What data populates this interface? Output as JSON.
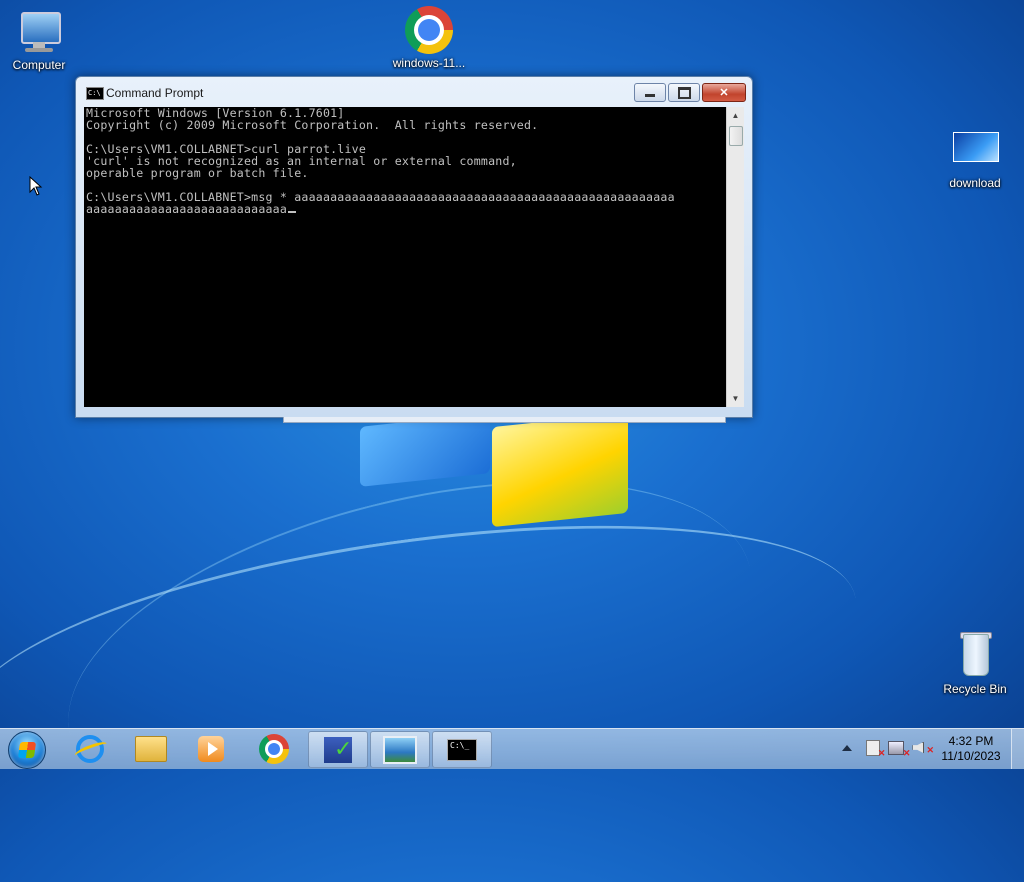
{
  "desktop": {
    "icons": [
      {
        "label": "Computer",
        "icon": "computer-icon"
      },
      {
        "label": "windows-11...",
        "icon": "chrome-icon"
      },
      {
        "label": "download",
        "icon": "image-file-icon"
      },
      {
        "label": "Recycle Bin",
        "icon": "recycle-bin-icon"
      }
    ]
  },
  "window": {
    "title": "Command Prompt",
    "icon": "cmd-icon",
    "buttons": {
      "minimize": "minimize-icon",
      "maximize": "maximize-icon",
      "close": "close-icon"
    },
    "console_lines": [
      "Microsoft Windows [Version 6.1.7601]",
      "Copyright (c) 2009 Microsoft Corporation.  All rights reserved.",
      "",
      "C:\\Users\\VM1.COLLABNET>curl parrot.live",
      "'curl' is not recognized as an internal or external command,",
      "operable program or batch file.",
      "",
      "C:\\Users\\VM1.COLLABNET>msg * aaaaaaaaaaaaaaaaaaaaaaaaaaaaaaaaaaaaaaaaaaaaaaaaaaaaa",
      "aaaaaaaaaaaaaaaaaaaaaaaaaaaa"
    ],
    "colors": {
      "console_bg": "#000000",
      "console_fg": "#c0c0c0"
    }
  },
  "taskbar": {
    "start": "windows-start-icon",
    "pinned": [
      "internet-explorer-icon",
      "file-explorer-icon",
      "media-player-icon",
      "chrome-icon",
      "document-app-icon",
      "picture-viewer-icon",
      "cmd-icon"
    ],
    "tray": [
      "show-hidden-icons-icon",
      "action-center-icon",
      "network-icon",
      "volume-muted-icon"
    ],
    "clock": {
      "time": "4:32 PM",
      "date": "11/10/2023"
    }
  }
}
